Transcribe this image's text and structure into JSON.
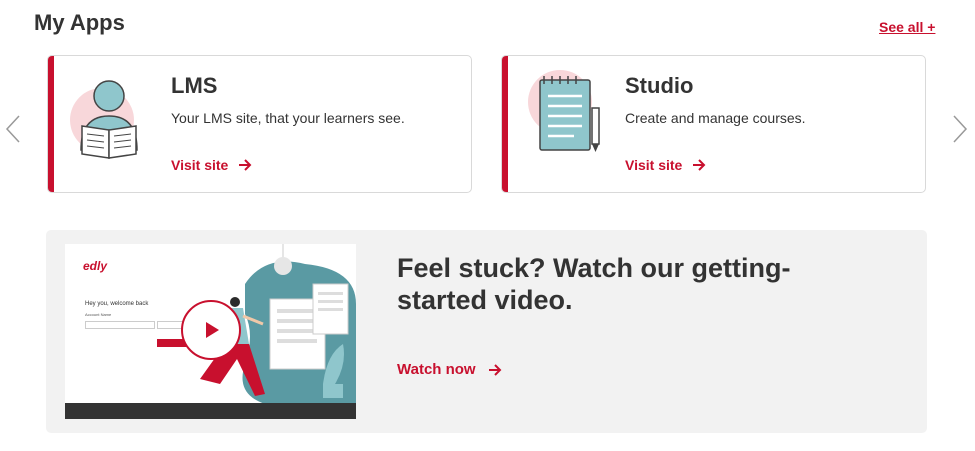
{
  "header": {
    "title": "My Apps",
    "see_all": "See all +"
  },
  "nav": {
    "prev_icon": "chevron-left-icon",
    "next_icon": "chevron-right-icon"
  },
  "apps": [
    {
      "title": "LMS",
      "description": "Your LMS site, that your learners see.",
      "link": "Visit site",
      "icon": "reader-icon"
    },
    {
      "title": "Studio",
      "description": "Create and manage courses.",
      "link": "Visit site",
      "icon": "notepad-icon"
    }
  ],
  "video": {
    "heading": "Feel stuck? Watch our getting-started video.",
    "link": "Watch now",
    "thumbnail": {
      "logo": "edly",
      "welcome": "Hey you, welcome back",
      "field_label": "Account Name"
    }
  },
  "colors": {
    "accent": "#c8102e",
    "illustration_pink": "#f8d7da",
    "illustration_teal": "#8fc6cc",
    "panel_bg": "#f2f2f2"
  }
}
